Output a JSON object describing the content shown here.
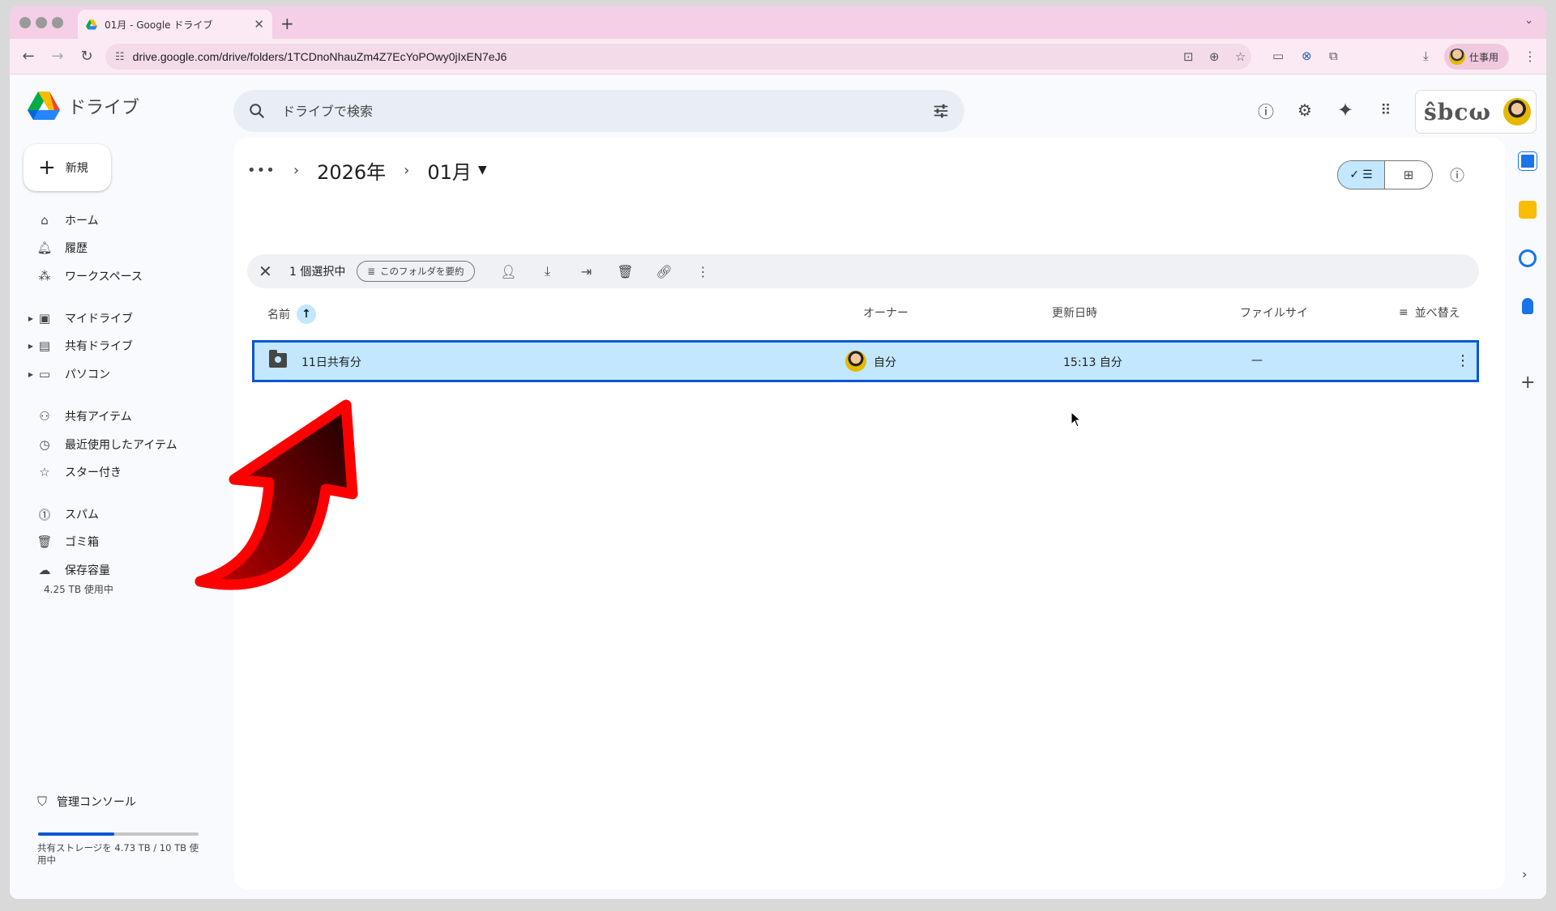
{
  "browser": {
    "tab_title": "01月 - Google ドライブ",
    "url": "drive.google.com/drive/folders/1TCDnoNhauZm4Z7EcYoPOwy0jIxEN7eJ6",
    "profile_label": "仕事用"
  },
  "drive": {
    "logo_text": "ドライブ",
    "search_placeholder": "ドライブで検索",
    "new_button": "新規"
  },
  "sidebar": {
    "items": [
      {
        "label": "ホーム",
        "icon": "home-icon"
      },
      {
        "label": "履歴",
        "icon": "bell-icon"
      },
      {
        "label": "ワークスペース",
        "icon": "workspace-icon"
      },
      {
        "label": "マイドライブ",
        "icon": "my-drive-icon"
      },
      {
        "label": "共有ドライブ",
        "icon": "shared-drive-icon"
      },
      {
        "label": "パソコン",
        "icon": "computer-icon"
      },
      {
        "label": "共有アイテム",
        "icon": "people-icon"
      },
      {
        "label": "最近使用したアイテム",
        "icon": "clock-icon"
      },
      {
        "label": "スター付き",
        "icon": "star-icon"
      },
      {
        "label": "スパム",
        "icon": "spam-icon"
      },
      {
        "label": "ゴミ箱",
        "icon": "trash-icon"
      },
      {
        "label": "保存容量",
        "icon": "cloud-icon"
      }
    ],
    "storage_used": "4.25 TB 使用中",
    "admin_console": "管理コンソール",
    "shared_storage_text": "共有ストレージを 4.73 TB / 10 TB 使用中",
    "shared_storage_fraction": 0.473
  },
  "breadcrumb": {
    "more": "•••",
    "parent": "2026年",
    "current": "01月"
  },
  "selection": {
    "count_text": "1 個選択中",
    "summarize_label": "このフォルダを要約"
  },
  "columns": {
    "name": "名前",
    "owner": "オーナー",
    "modified": "更新日時",
    "size": "ファイルサイ",
    "sort": "並べ替え"
  },
  "rows": [
    {
      "name": "11日共有分",
      "owner": "自分",
      "modified": "15:13 自分",
      "size": "—"
    }
  ],
  "colors": {
    "accent": "#0b57d0",
    "selected_row": "#c2e7ff",
    "arrow": "#ff0000"
  }
}
